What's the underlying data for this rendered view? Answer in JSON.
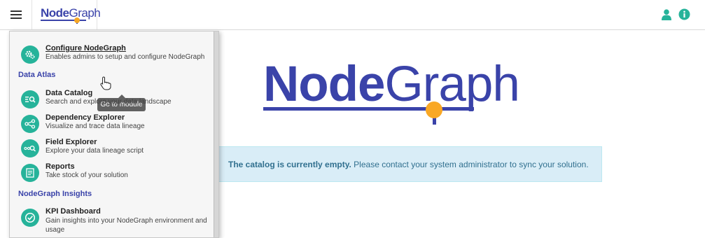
{
  "header": {
    "brand_node": "Node",
    "brand_graph": "Graph",
    "user_icon": "user-icon",
    "info_icon": "info-icon",
    "menu_icon": "hamburger-icon"
  },
  "logo": {
    "node": "Node",
    "graph": "Graph"
  },
  "banner": {
    "bold": "The catalog is currently empty.",
    "text": "Please contact your system administrator to sync your solution."
  },
  "menu": {
    "configure": {
      "title": "Configure NodeGraph",
      "desc": "Enables admins to setup and configure NodeGraph",
      "icon": "gears-icon"
    },
    "tooltip": "Go to module",
    "section_atlas": "Data Atlas",
    "items_atlas": [
      {
        "title": "Data Catalog",
        "desc": "Search and explore your data landscape",
        "icon": "catalog-search-icon"
      },
      {
        "title": "Dependency Explorer",
        "desc": "Visualize and trace data lineage",
        "icon": "share-nodes-icon"
      },
      {
        "title": "Field Explorer",
        "desc": "Explore your data lineage script",
        "icon": "field-search-icon"
      },
      {
        "title": "Reports",
        "desc": "Take stock of your solution",
        "icon": "report-icon"
      }
    ],
    "section_insights": "NodeGraph Insights",
    "kpi": {
      "title": "KPI Dashboard",
      "desc": "Gain insights into your NodeGraph environment and usage",
      "icon": "check-circle-icon"
    }
  },
  "colors": {
    "brand": "#3a43a9",
    "accent": "#f9a825",
    "teal": "#26b39a",
    "banner_bg": "#d9edf7",
    "banner_text": "#31708f"
  }
}
